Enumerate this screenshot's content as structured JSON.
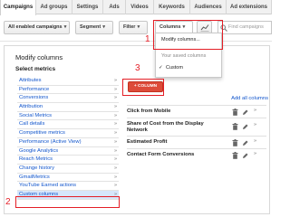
{
  "tabs": [
    "Campaigns",
    "Ad groups",
    "Settings",
    "Ads",
    "Videos",
    "Keywords",
    "Audiences",
    "Ad extensions"
  ],
  "toolbar": {
    "campaign_filter": "All enabled campaigns",
    "segment": "Segment",
    "filter": "Filter",
    "columns": "Columns",
    "search_placeholder": "Find campaigns"
  },
  "dropdown": {
    "modify": "Modify columns...",
    "saved_header": "Your saved columns",
    "custom": "Custom"
  },
  "panel": {
    "title": "Modify columns",
    "subtitle": "Select metrics",
    "metrics": [
      "Attributes",
      "Performance",
      "Conversions",
      "Attribution",
      "Social Metrics",
      "Call details",
      "Competitive metrics",
      "Performance (Active View)",
      "Google Analytics",
      "Reach Metrics",
      "Change history",
      "GmailMetrics",
      "YouTube Earned actions",
      "Custom columns"
    ],
    "add_column": "+ COLUMN",
    "add_all": "Add all columns",
    "columns": [
      "Click from Mobile",
      "Share of Cost from the Display Network",
      "Estimated Profit",
      "Contact Form Conversions"
    ]
  },
  "annotations": [
    "1",
    "2",
    "3"
  ],
  "colors": {
    "accent_red": "#dd4b39",
    "link_blue": "#1155cc",
    "annotation_red": "#e41e26"
  }
}
